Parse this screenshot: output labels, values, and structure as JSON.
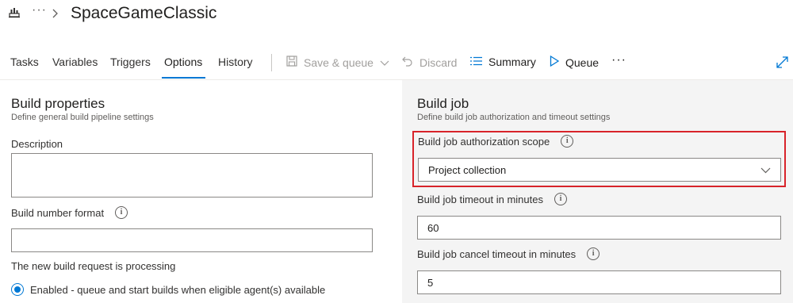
{
  "header": {
    "more_glyph": "···",
    "title": "SpaceGameClassic"
  },
  "tabs": [
    {
      "label": "Tasks"
    },
    {
      "label": "Variables"
    },
    {
      "label": "Triggers"
    },
    {
      "label": "Options"
    },
    {
      "label": "History"
    }
  ],
  "toolbar": {
    "save_queue": "Save & queue",
    "discard": "Discard",
    "summary": "Summary",
    "queue": "Queue",
    "more_glyph": "···"
  },
  "build_properties": {
    "title": "Build properties",
    "subtitle": "Define general build pipeline settings",
    "description_label": "Description",
    "description_value": "",
    "build_number_label": "Build number format",
    "build_number_value": "",
    "processing_label": "The new build request is processing",
    "enabled_option": "Enabled - queue and start builds when eligible agent(s) available"
  },
  "build_job": {
    "title": "Build job",
    "subtitle": "Define build job authorization and timeout settings",
    "scope_label": "Build job authorization scope",
    "scope_value": "Project collection",
    "timeout_label": "Build job timeout in minutes",
    "timeout_value": "60",
    "cancel_timeout_label": "Build job cancel timeout in minutes",
    "cancel_timeout_value": "5"
  },
  "colors": {
    "accent": "#0078d4",
    "highlight": "#d8232a",
    "panel_bg": "#f4f4f4"
  },
  "icons": {
    "pipeline": "pipeline-icon",
    "breadcrumb_chevron": "chevron-right-icon",
    "save": "save-icon",
    "dropdown": "chevron-down-icon",
    "discard": "undo-icon",
    "summary": "list-icon",
    "queue": "play-icon",
    "expand": "expand-icon",
    "info": "info-icon"
  }
}
